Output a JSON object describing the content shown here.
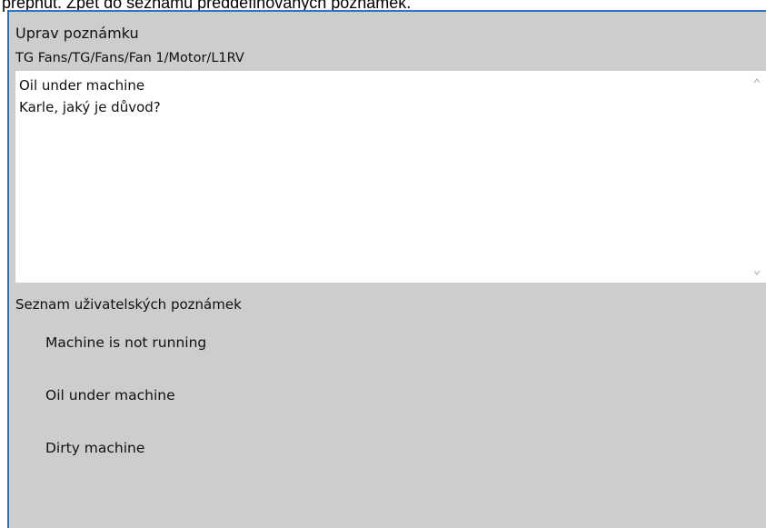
{
  "header_clip": "prepnut. Zpět do seznamu předdefinovaných poznámek.",
  "dialog": {
    "title": "Uprav poznámku",
    "path": "TG Fans/TG/Fans/Fan 1/Motor/L1RV",
    "note_lines": [
      "Oil under machine",
      "Karle, jaký je důvod?"
    ]
  },
  "user_notes": {
    "label": "Seznam uživatelských poznámek",
    "items": [
      {
        "label": "Machine is not running"
      },
      {
        "label": "Oil under machine"
      },
      {
        "label": "Dirty machine"
      }
    ]
  },
  "colors": {
    "dialog_background": "#cdcdcd",
    "accent_border": "#2e74c0"
  },
  "icons": {
    "scroll_up": "chevron-up-icon",
    "scroll_down": "chevron-down-icon"
  }
}
